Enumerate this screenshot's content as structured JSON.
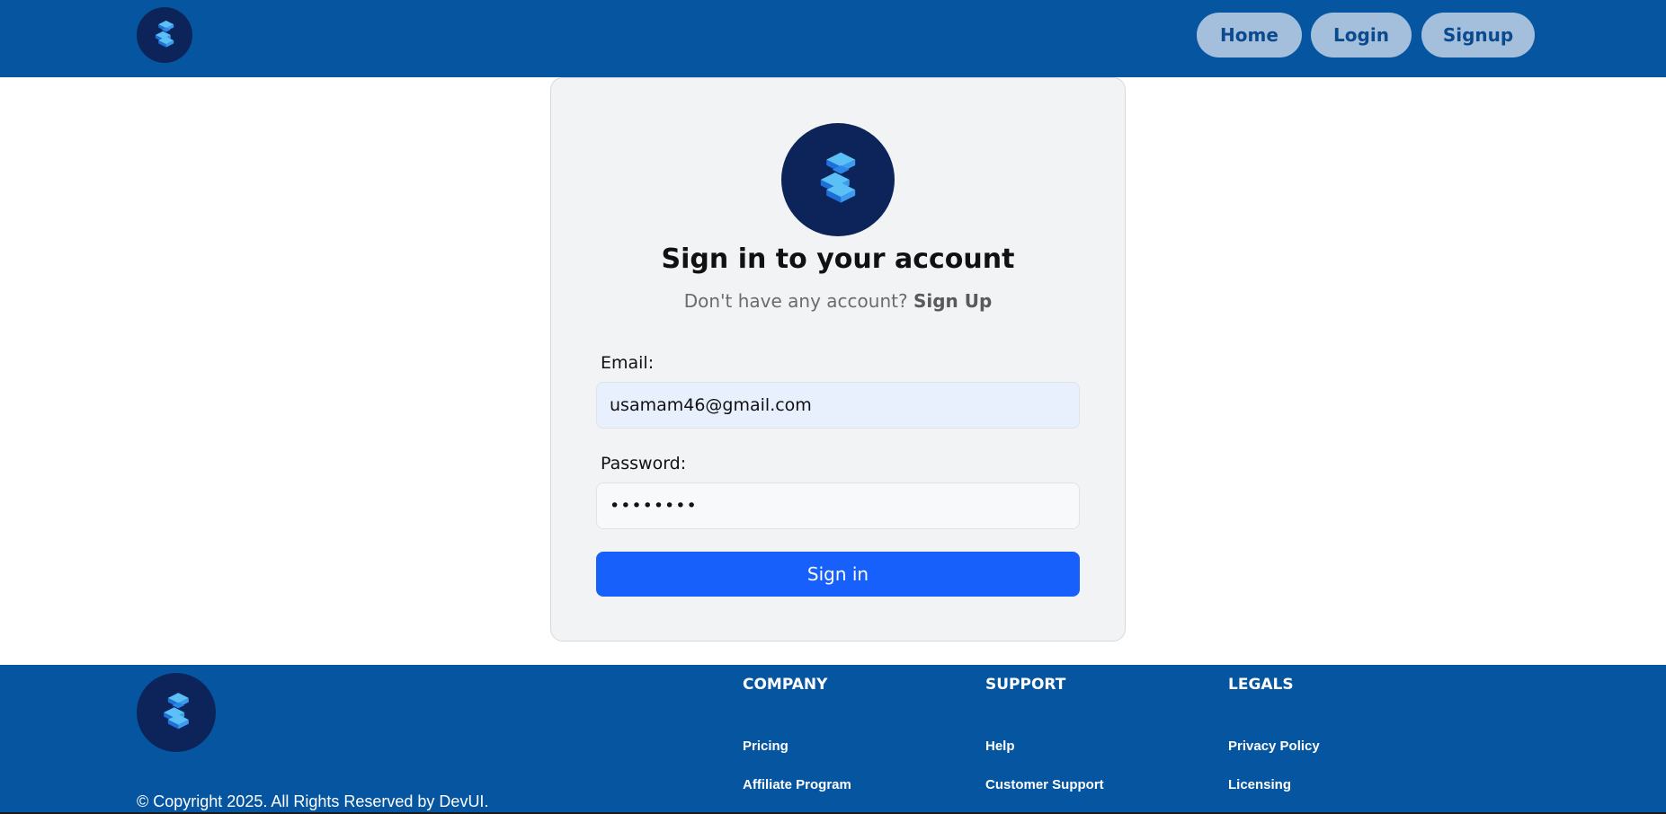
{
  "colors": {
    "header_bg": "#0655a0",
    "logo_bg": "#0c2459",
    "nav_button_bg": "#a3bfdc",
    "nav_button_text": "#0b4a8f",
    "primary_button": "#1860fc",
    "card_bg": "#f2f3f5"
  },
  "header": {
    "logo_icon": "devui-cube-logo-icon",
    "nav": {
      "home": "Home",
      "login": "Login",
      "signup": "Signup"
    }
  },
  "login_card": {
    "logo_icon": "devui-cube-logo-icon",
    "title": "Sign in to your account",
    "subtitle_prefix": "Don't have any account?",
    "subtitle_link": "Sign Up",
    "email": {
      "label": "Email:",
      "value": "usamam46@gmail.com"
    },
    "password": {
      "label": "Password:",
      "value": "••••••••"
    },
    "submit_label": "Sign in"
  },
  "footer": {
    "logo_icon": "devui-cube-logo-icon",
    "copyright": "© Copyright 2025. All Rights Reserved by DevUI.",
    "columns": [
      {
        "title": "COMPANY",
        "links": [
          "Pricing",
          "Affiliate Program"
        ]
      },
      {
        "title": "SUPPORT",
        "links": [
          "Help",
          "Customer Support"
        ]
      },
      {
        "title": "LEGALS",
        "links": [
          "Privacy Policy",
          "Licensing"
        ]
      }
    ]
  }
}
